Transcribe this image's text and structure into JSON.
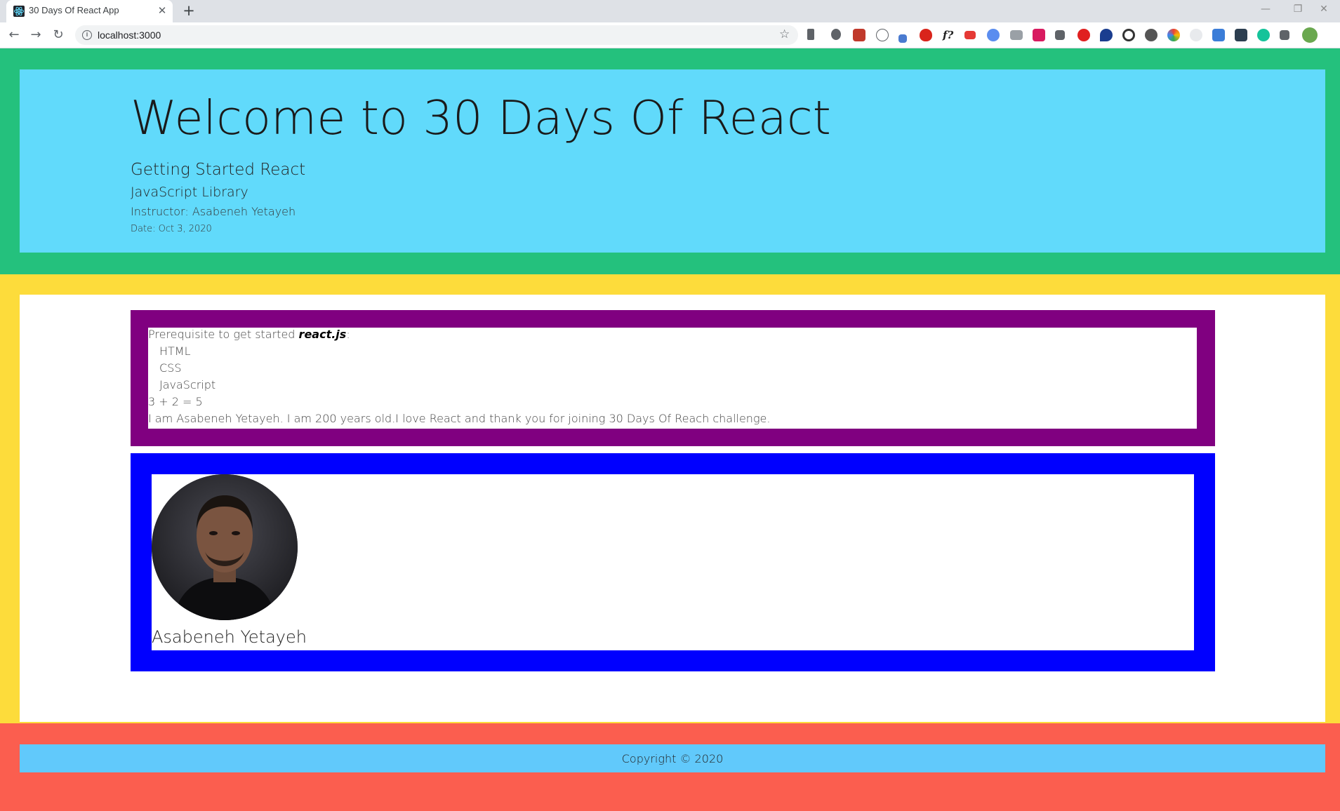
{
  "browser": {
    "tab_title": "30 Days Of React App",
    "tab_close": "✕",
    "new_tab": "+",
    "url": "localhost:3000",
    "window_controls": {
      "minimize": "—",
      "restore": "❐",
      "close": "✕"
    },
    "extension_icons": [
      "bookmarks-icon",
      "bug-icon",
      "image-icon",
      "braces-icon",
      "pen-icon",
      "ublock-icon",
      "font-icon",
      "megaphone-icon",
      "info-icon",
      "camera-icon",
      "color-icon",
      "tool-icon",
      "record-icon",
      "heart-icon",
      "g-icon",
      "wordpress-icon",
      "color-wheel-icon",
      "octocat-icon",
      "lighthouse-icon",
      "screenshot-icon",
      "grammarly-icon",
      "puzzle-icon",
      "avatar-icon"
    ]
  },
  "header": {
    "title": "Welcome to 30 Days Of React",
    "subtitle": "Getting Started React",
    "library": "JavaScript Library",
    "instructor": "Instructor: Asabeneh Yetayeh",
    "date": "Date: Oct 3, 2020"
  },
  "main": {
    "prerequisite": {
      "intro": "Prerequisite to get started ",
      "emphasis": "react.js",
      "colon": ":",
      "skills": [
        "HTML",
        "CSS",
        "JavaScript"
      ],
      "math": "3 + 2 = 5",
      "bio": "I am Asabeneh Yetayeh. I am 200 years old.I love React and thank you for joining 30 Days Of Reach challenge."
    },
    "profile": {
      "name": "Asabeneh Yetayeh"
    }
  },
  "footer": {
    "copyright": "Copyright © 2020"
  },
  "colors": {
    "header_outer": "#24c17d",
    "header_inner": "#61dafb",
    "main_outer": "#fddc3b",
    "prereq_border": "#800080",
    "profile_border": "#0000ff",
    "footer_outer": "#fb5e4f",
    "footer_inner": "#61c9fb"
  }
}
